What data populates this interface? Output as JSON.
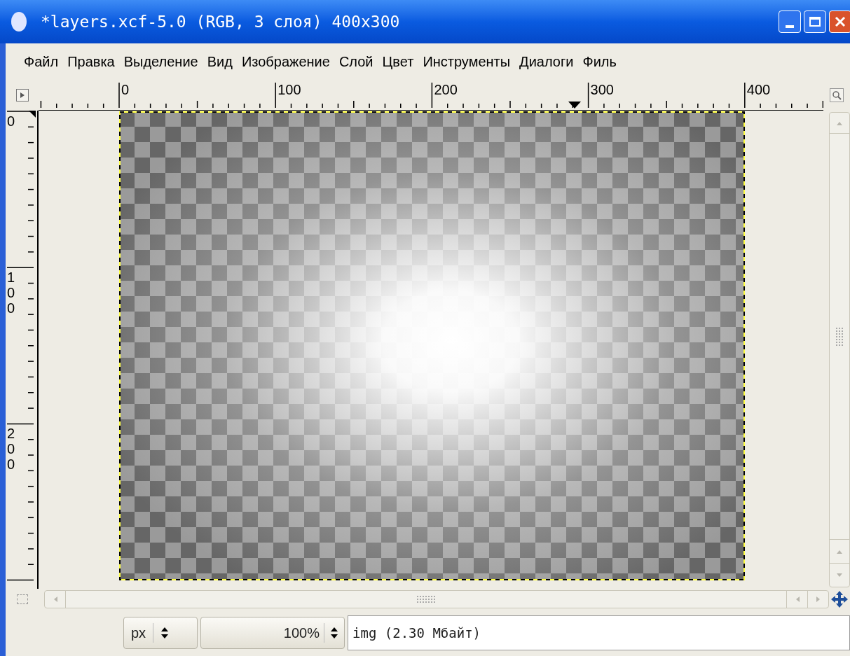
{
  "window": {
    "title": "*layers.xcf-5.0 (RGB, 3 слоя) 400x300"
  },
  "menu": [
    "Файл",
    "Правка",
    "Выделение",
    "Вид",
    "Изображение",
    "Слой",
    "Цвет",
    "Инструменты",
    "Диалоги",
    "Филь"
  ],
  "rulers": {
    "horizontal": [
      "0",
      "100",
      "200",
      "300",
      "400"
    ],
    "vertical": [
      "0",
      "100",
      "200"
    ]
  },
  "status_bar": {
    "unit": "px",
    "zoom": "100%",
    "info": "img (2.30 Мбайт)"
  }
}
